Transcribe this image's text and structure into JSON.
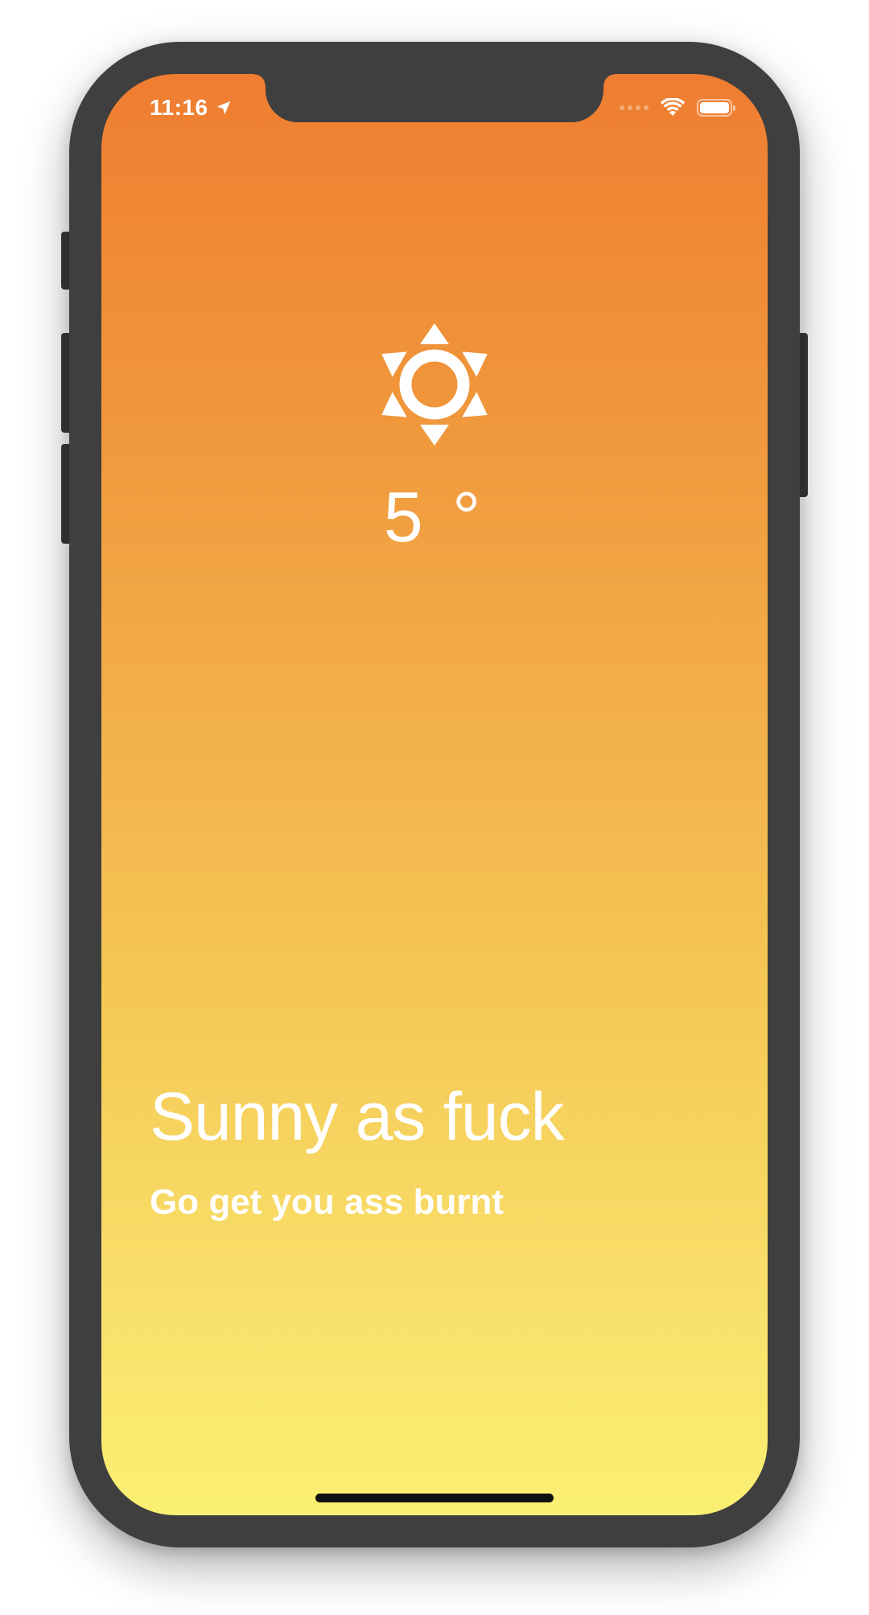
{
  "status_bar": {
    "time": "11:16",
    "location_icon": "location-arrow-icon",
    "wifi_icon": "wifi-icon",
    "battery_icon": "battery-icon",
    "battery_level": 1.0
  },
  "weather": {
    "icon": "sun-icon",
    "temperature": "5 °",
    "headline": "Sunny as fuck",
    "subline": "Go get you ass burnt"
  },
  "colors": {
    "gradient_top": "#ef7d31",
    "gradient_bottom": "#fbf073",
    "frame": "#3f3f3f",
    "text": "#ffffff"
  }
}
